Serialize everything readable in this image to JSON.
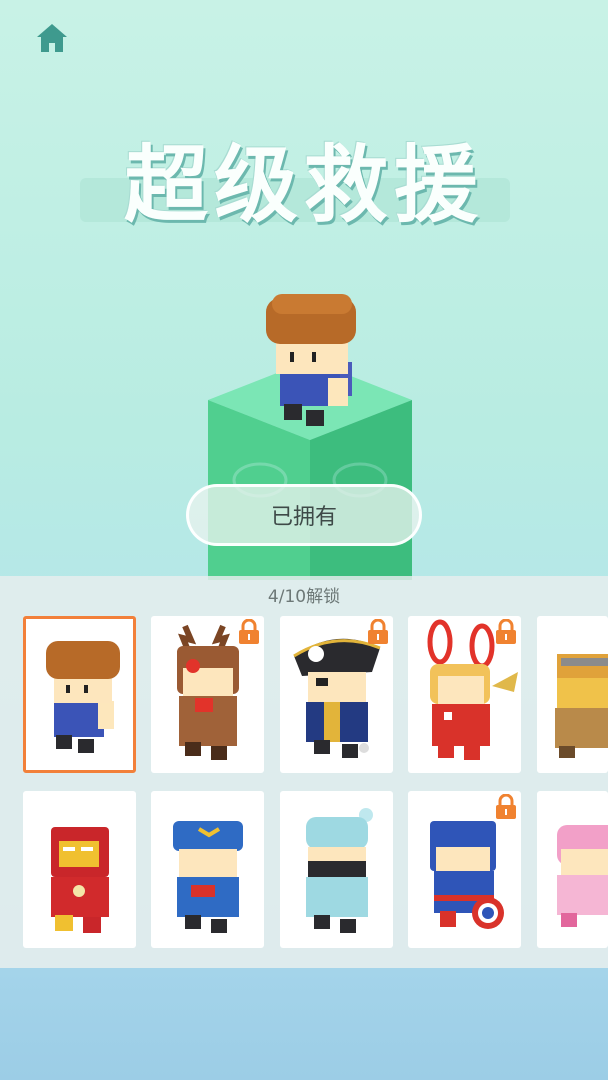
{
  "header": {
    "home_icon": "home-icon"
  },
  "title": "超级救援",
  "owned_button_label": "已拥有",
  "unlock_progress": "4/10解锁",
  "colors": {
    "accent_selected": "#f2803a",
    "lock": "#f08230",
    "pillar": "#4ed495"
  },
  "characters_row1": [
    {
      "icon": "boy-character-icon",
      "locked": false,
      "selected": true
    },
    {
      "icon": "reindeer-character-icon",
      "locked": true,
      "selected": false
    },
    {
      "icon": "pirate-character-icon",
      "locked": true,
      "selected": false
    },
    {
      "icon": "bunny-clown-character-icon",
      "locked": true,
      "selected": false
    },
    {
      "icon": "warrior-character-icon",
      "locked": false,
      "selected": false
    }
  ],
  "characters_row2": [
    {
      "icon": "iron-armor-character-icon",
      "locked": false,
      "selected": false
    },
    {
      "icon": "pilot-character-icon",
      "locked": false,
      "selected": false
    },
    {
      "icon": "beanie-character-icon",
      "locked": false,
      "selected": false
    },
    {
      "icon": "shield-hero-character-icon",
      "locked": true,
      "selected": false
    },
    {
      "icon": "pink-hair-character-icon",
      "locked": false,
      "selected": false
    }
  ]
}
